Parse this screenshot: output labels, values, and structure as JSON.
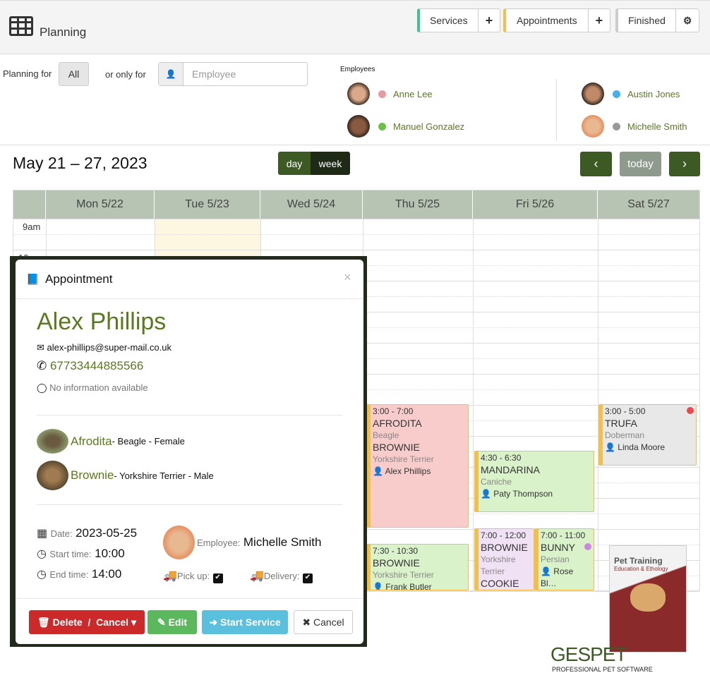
{
  "header": {
    "title": "Planning",
    "services": "Services",
    "appointments": "Appointments",
    "finished": "Finished",
    "colors": {
      "services": "#3cc68a",
      "appointments": "#f0c04a",
      "finished": "#ccc"
    }
  },
  "filters": {
    "planning_for": "Planning for",
    "all": "All",
    "or_only_for": "or only for",
    "employee_placeholder": "Employee",
    "employees_label": "Employees",
    "employees": [
      {
        "name": "Anne Lee",
        "color": "#e79aa0"
      },
      {
        "name": "Manuel Gonzalez",
        "color": "#6cc04a"
      },
      {
        "name": "Austin Jones",
        "color": "#4aaeea"
      },
      {
        "name": "Michelle Smith",
        "color": "#999"
      }
    ]
  },
  "calendar": {
    "range": "May 21 – 27, 2023",
    "day": "day",
    "week": "week",
    "today": "today",
    "days": [
      "Mon 5/22",
      "Tue 5/23",
      "Wed 5/24",
      "Thu 5/25",
      "Fri 5/26",
      "Sat 5/27"
    ],
    "times": [
      "9am",
      "10am"
    ],
    "events": [
      {
        "time": "3:00 - 7:00",
        "pets": [
          {
            "name": "AFRODITA",
            "breed": "Beagle"
          },
          {
            "name": "BROWNIE",
            "breed": "Yorkshire Terrier"
          }
        ],
        "owner": "Alex Phillips",
        "bg": "#f9cccc"
      },
      {
        "time": "7:30 - 10:30",
        "pets": [
          {
            "name": "BROWNIE",
            "breed": "Yorkshire Terrier"
          }
        ],
        "owner": "Frank Butler",
        "bg": "#d9f2c9"
      },
      {
        "time": "4:30 - 6:30",
        "pets": [
          {
            "name": "MANDARINA",
            "breed": "Caniche"
          }
        ],
        "owner": "Paty Thompson",
        "bg": "#d9f2c9"
      },
      {
        "time": "7:00 - 12:00",
        "pets": [
          {
            "name": "BROWNIE",
            "breed": "Yorkshire Terrier"
          },
          {
            "name": "COOKIE",
            "breed": ""
          }
        ],
        "owner": "",
        "bg": "#f1e1f5"
      },
      {
        "time": "7:00 - 11:00",
        "pets": [
          {
            "name": "BUNNY",
            "breed": "Persian"
          }
        ],
        "owner": "Rose Bl…",
        "bg": "#d9f2c9",
        "dot": "#cc88dd"
      },
      {
        "time": "3:00 - 5:00",
        "pets": [
          {
            "name": "TRUFA",
            "breed": "Doberman"
          }
        ],
        "owner": "Linda Moore",
        "bg": "#e8e8e8",
        "dot": "#f04848"
      }
    ]
  },
  "modal": {
    "title": "Appointment",
    "client": "Alex Phillips",
    "email": "alex-phillips@super-mail.co.uk",
    "phone": "67733444885566",
    "whatsapp": "No information available",
    "pets": [
      {
        "name": "Afrodita",
        "details": " - Beagle - Female"
      },
      {
        "name": "Brownie",
        "details": " - Yorkshire Terrier - Male"
      }
    ],
    "date_label": "Date:",
    "date": "2023-05-25",
    "start_label": "Start time:",
    "start": "10:00",
    "end_label": "End time:",
    "end": "14:00",
    "employee_label": "Employee:",
    "employee": "Michelle Smith",
    "pickup_label": "Pick up:",
    "pickup": true,
    "delivery_label": "Delivery:",
    "delivery": true,
    "delete": "Delete  /  Cancel",
    "edit": "Edit",
    "start_service": "Start Service",
    "cancel": "Cancel"
  },
  "logo": {
    "box_title": "Pet Training",
    "box_subtitle": "Education & Ethology",
    "brand": "GESPET",
    "tagline": "PROFESSIONAL PET SOFTWARE"
  }
}
